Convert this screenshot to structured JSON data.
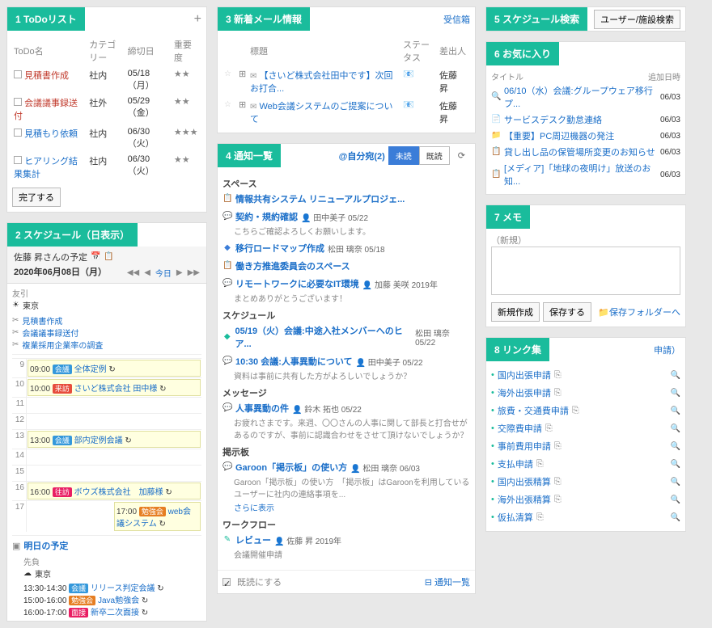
{
  "portlets": {
    "todo": {
      "title": "1 ToDoリスト",
      "add": "+"
    },
    "schedule": {
      "title": "2 スケジュール（日表示）"
    },
    "mail": {
      "title": "3 新着メール情報",
      "inbox": "受信箱"
    },
    "notif": {
      "title": "4 通知一覧"
    },
    "search": {
      "title": "5 スケジュール検索",
      "button": "ユーザー/施設検索"
    },
    "fav": {
      "title": "6 お気に入り"
    },
    "memo": {
      "title": "7 メモ"
    },
    "links": {
      "title": "8 リンク集",
      "badge": "申請）"
    }
  },
  "todo": {
    "headers": [
      "ToDo名",
      "カテゴリー",
      "締切日",
      "重要度"
    ],
    "rows": [
      {
        "name": "見積書作成",
        "cat": "社内",
        "due": "05/18（月）",
        "pri": "★★",
        "red": true
      },
      {
        "name": "会議議事録送付",
        "cat": "社外",
        "due": "05/29（金）",
        "pri": "★★",
        "red": true
      },
      {
        "name": "見積もり依頼",
        "cat": "社内",
        "due": "06/30（火）",
        "pri": "★★★",
        "red": false
      },
      {
        "name": "ヒアリング結果集計",
        "cat": "社内",
        "due": "06/30（火）",
        "pri": "★★",
        "red": false
      }
    ],
    "complete": "完了する"
  },
  "sched": {
    "title": "佐藤 昇さんの予定",
    "date": "2020年06月08日（月）",
    "today": "今日",
    "rokuyo": "友引",
    "weather": "東京",
    "allday": [
      "見積書作成",
      "会議議事録送付",
      "複業採用企業率の調査"
    ],
    "tomorrow": "明日の予定",
    "tomorrow_rokuyo": "先負",
    "tomorrow_events": [
      {
        "time": "13:30-14:30",
        "tag": "会議",
        "title": "リリース判定会議",
        "tagClass": "tag-blue"
      },
      {
        "time": "15:00-16:00",
        "tag": "勉強会",
        "title": "Java勉強会",
        "tagClass": "tag-orange"
      },
      {
        "time": "16:00-17:00",
        "tag": "面接",
        "title": "新卒二次面接",
        "tagClass": "tag-pink"
      }
    ],
    "hours": [
      {
        "h": "9",
        "events": [
          {
            "time": "09:00",
            "tag": "会議",
            "title": "全体定例",
            "tagClass": "tag-blue"
          }
        ]
      },
      {
        "h": "10",
        "events": [
          {
            "time": "10:00",
            "tag": "来訪",
            "title": "さいど株式会社 田中様",
            "tagClass": "tag-red"
          }
        ]
      },
      {
        "h": "11",
        "events": []
      },
      {
        "h": "12",
        "events": []
      },
      {
        "h": "13",
        "events": [
          {
            "time": "13:00",
            "tag": "会議",
            "title": "部内定例会議",
            "tagClass": "tag-blue"
          }
        ]
      },
      {
        "h": "14",
        "events": []
      },
      {
        "h": "15",
        "events": []
      },
      {
        "h": "16",
        "events": [
          {
            "time": "16:00",
            "tag": "往訪",
            "title": "ボウズ株式会社　加藤様",
            "tagClass": "tag-pink"
          }
        ]
      },
      {
        "h": "17",
        "events": [
          {
            "time": "17:00",
            "tag": "勉強会",
            "title": "web会議システム",
            "tagClass": "tag-orange",
            "half": true
          }
        ]
      }
    ]
  },
  "mail": {
    "headers": [
      "標題",
      "ステータス",
      "差出人"
    ],
    "rows": [
      {
        "subj": "【さいど株式会社田中です】次回お打合...",
        "from": "佐藤 昇"
      },
      {
        "subj": "Web会議システムのご提案について",
        "from": "佐藤 昇"
      }
    ]
  },
  "notif": {
    "filter_label": "@自分宛(2)",
    "tabs": [
      "未読",
      "既読"
    ],
    "sections": [
      {
        "name": "スペース",
        "items": [
          {
            "title": "情報共有システム リニューアルプロジェ...",
            "icon": "📋"
          },
          {
            "title": "契約・規約確認",
            "sub": "こちらご確認よろしくお願いします。",
            "meta": "田中美子 05/22",
            "icon": "💬",
            "person": true
          },
          {
            "title": "移行ロードマップ作成",
            "meta": "松田 璃奈 05/18",
            "icon": "◆"
          },
          {
            "title": "働き方推進委員会のスペース",
            "icon": "📋"
          },
          {
            "title": "リモートワークに必要なIT環境",
            "sub": "まとめありがとうございます！",
            "meta": "加藤 美咲 2019年",
            "icon": "💬",
            "person": true
          }
        ]
      },
      {
        "name": "スケジュール",
        "items": [
          {
            "title": "05/19（火）会議:中途入社メンバーへのヒア...",
            "meta": "松田 璃奈 05/22",
            "icon": "◆",
            "green": true
          },
          {
            "title": "10:30 会議:人事異動について",
            "sub": "資料は事前に共有した方がよろしいでしょうか？",
            "meta": "田中美子 05/22",
            "icon": "💬",
            "person": true
          }
        ]
      },
      {
        "name": "メッセージ",
        "items": [
          {
            "title": "人事異動の件",
            "sub": "お疲れさまです。来週、〇〇さんの人事に関して部長と打合せがあるのですが、事前に認識合わせをさせて頂けないでしょうか？",
            "meta": "鈴木 拓也 05/22",
            "icon": "💬",
            "person": true
          }
        ]
      },
      {
        "name": "掲示板",
        "items": [
          {
            "title": "Garoon「掲示板」の使い方",
            "sub": "Garoon「掲示板」の使い方　「掲示板」はGaroonを利用しているユーザーに社内の連絡事項を...",
            "more": "さらに表示",
            "meta": "松田 璃奈 06/03",
            "icon": "💬",
            "person": true
          }
        ]
      },
      {
        "name": "ワークフロー",
        "items": [
          {
            "title": "レビュー",
            "sub": "会議開催申請",
            "meta": "佐藤 昇 2019年",
            "icon": "✎",
            "person": true,
            "green": true
          }
        ]
      }
    ],
    "mark_read": "既読にする",
    "all": "通知一覧"
  },
  "fav": {
    "headers": [
      "タイトル",
      "追加日時"
    ],
    "rows": [
      {
        "icon": "🔍",
        "title": "06/10（水）会議:グループウェア移行プ...",
        "date": "06/03"
      },
      {
        "icon": "📄",
        "title": "サービスデスク勤怠連絡",
        "date": "06/03"
      },
      {
        "icon": "📁",
        "title": "【重要】PC周辺機器の発注",
        "date": "06/03"
      },
      {
        "icon": "📋",
        "title": "貸し出し品の保管場所変更のお知らせ",
        "date": "06/03"
      },
      {
        "icon": "📋",
        "title": "[メディア]「地球の夜明け」放送のお知...",
        "date": "06/03"
      }
    ]
  },
  "memo": {
    "new_label": "（新規）",
    "create": "新規作成",
    "save": "保存する",
    "folder": "保存フォルダーへ"
  },
  "links": {
    "items": [
      "国内出張申請",
      "海外出張申請",
      "旅費・交通費申請",
      "交際費申請",
      "事前費用申請",
      "支払申請",
      "国内出張精算",
      "海外出張精算",
      "仮払清算"
    ]
  }
}
